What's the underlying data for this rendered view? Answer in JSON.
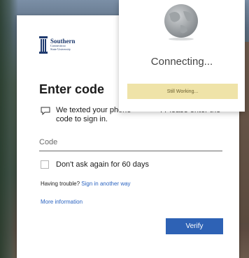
{
  "logo": {
    "line1": "Southern",
    "line2": "Connecticut",
    "line3": "State University"
  },
  "signin": {
    "title": "Enter code",
    "message": "We texted your phone ••••••••••. Please enter the code to sign in.",
    "code_placeholder": "Code",
    "remember_label": "Don't ask again for 60 days",
    "trouble_prefix": "Having trouble?",
    "trouble_link": "Sign in another way",
    "more_info": "More information",
    "verify_label": "Verify"
  },
  "popup": {
    "connecting": "Connecting...",
    "status": "Still Working..."
  },
  "colors": {
    "accent": "#2e62b5",
    "link": "#2a63c0",
    "status_bg": "#efe3a8",
    "brand": "#1f3a6e"
  }
}
